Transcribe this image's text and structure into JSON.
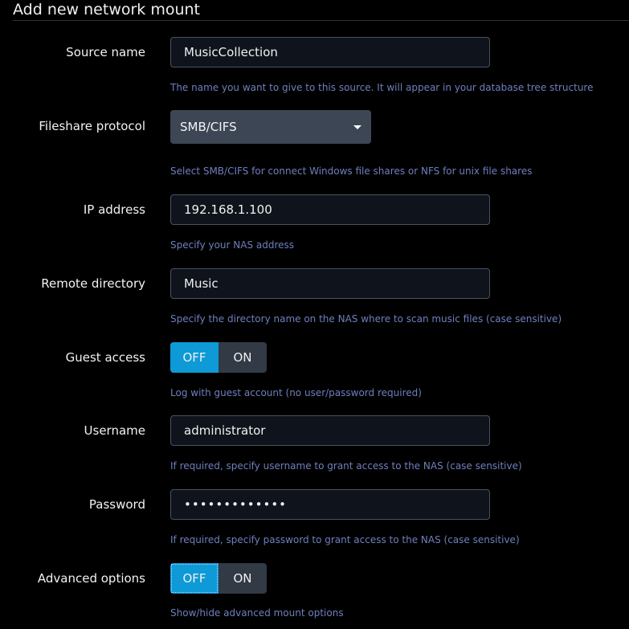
{
  "title": "Add new network mount",
  "source_name": {
    "label": "Source name",
    "value": "MusicCollection",
    "help": "The name you want to give to this source. It will appear in your database tree structure"
  },
  "protocol": {
    "label": "Fileshare protocol",
    "selected": "SMB/CIFS",
    "help": "Select SMB/CIFS for connect Windows file shares or NFS for unix file shares"
  },
  "ip": {
    "label": "IP address",
    "value": "192.168.1.100",
    "help": "Specify your NAS address"
  },
  "remote_dir": {
    "label": "Remote directory",
    "value": "Music",
    "help": "Specify the directory name on the NAS where to scan music files (case sensitive)"
  },
  "guest": {
    "label": "Guest access",
    "off_label": "OFF",
    "on_label": "ON",
    "state": "OFF",
    "help": "Log with guest account (no user/password required)"
  },
  "username": {
    "label": "Username",
    "value": "administrator",
    "help": "If required, specify username to grant access to the NAS (case sensitive)"
  },
  "password": {
    "label": "Password",
    "value": "•••••••••••••",
    "help": "If required, specify password to grant access to the NAS (case sensitive)"
  },
  "advanced": {
    "label": "Advanced options",
    "off_label": "OFF",
    "on_label": "ON",
    "state": "OFF",
    "help": "Show/hide advanced mount options"
  },
  "colors": {
    "accent": "#0d9ad6",
    "help_text": "#6f7fbe",
    "background": "#000000"
  }
}
